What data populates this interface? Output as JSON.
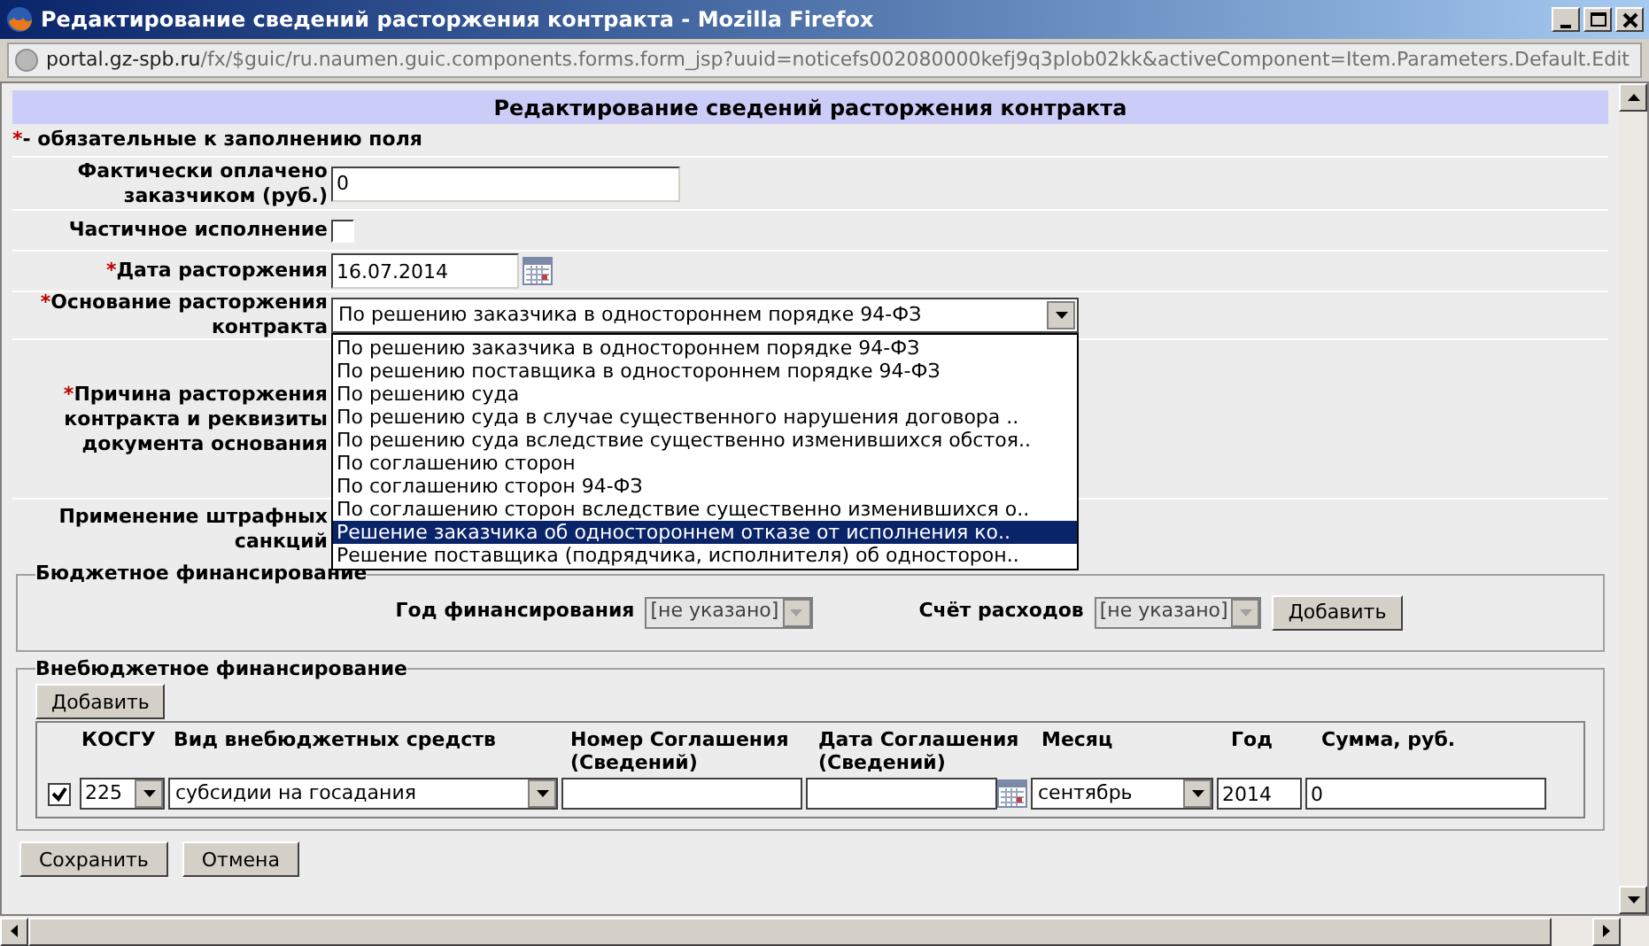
{
  "window": {
    "title": "Редактирование сведений расторжения контракта - Mozilla Firefox",
    "url_host": "portal.gz-spb.ru",
    "url_path": "/fx/$guic/ru.naumen.guic.components.forms.form_jsp?uuid=noticefs002080000kefj9q3plob02kk&activeComponent=Item.Parameters.Default.Edit"
  },
  "form": {
    "title": "Редактирование сведений расторжения контракта",
    "required_mark": "*",
    "required_note": " - обязательные к заполнению поля",
    "fields": [
      {
        "kind": "text",
        "label": "Фактически оплачено заказчиком (руб.)",
        "required": false,
        "value": "0"
      },
      {
        "kind": "checkbox",
        "label": "Частичное исполнение",
        "required": false,
        "checked": false
      },
      {
        "kind": "date",
        "label": "Дата расторжения",
        "required": true,
        "value": "16.07.2014"
      },
      {
        "kind": "select",
        "label": "Основание расторжения контракта",
        "required": true,
        "value": "По решению заказчика в одностороннем порядке 94-ФЗ",
        "expanded": true,
        "options": [
          {
            "label": "По решению заказчика в одностороннем порядке 94-ФЗ",
            "highlighted": false
          },
          {
            "label": "По решению поставщика в одностороннем порядке 94-ФЗ",
            "highlighted": false
          },
          {
            "label": "По решению суда",
            "highlighted": false
          },
          {
            "label": "По решению суда в случае существенного нарушения договора ..",
            "highlighted": false
          },
          {
            "label": "По решению суда вследствие существенно изменившихся обстоя..",
            "highlighted": false
          },
          {
            "label": "По соглашению сторон",
            "highlighted": false
          },
          {
            "label": "По соглашению сторон 94-ФЗ",
            "highlighted": false
          },
          {
            "label": "По соглашению сторон вследствие существенно изменившихся о..",
            "highlighted": false
          },
          {
            "label": "Решение заказчика об одностороннем отказе от исполнения ко..",
            "highlighted": true
          },
          {
            "label": "Решение поставщика (подрядчика, исполнителя) об односторон..",
            "highlighted": false
          }
        ]
      },
      {
        "kind": "tall",
        "label": "Причина расторжения контракта и реквизиты документа основания",
        "required": true
      },
      {
        "kind": "blank",
        "label": "Применение штрафных санкций",
        "required": false
      }
    ]
  },
  "budget": {
    "legend": "Бюджетное финансирование",
    "year_label": "Год финансирования",
    "year_value": "[не указано]",
    "account_label": "Счёт расходов",
    "account_value": "[не указано]",
    "disabled": true,
    "add_button": "Добавить"
  },
  "offbudget": {
    "legend": "Внебюджетное финансирование",
    "add_button": "Добавить",
    "columns": [
      "КОСГУ",
      "Вид внебюджетных средств",
      "Номер Соглашения (Сведений)",
      "Дата Соглашения (Сведений)",
      "Месяц",
      "Год",
      "Сумма, руб."
    ],
    "rows": [
      {
        "checked": true,
        "kosgu": "225",
        "type": "субсидии на госадания",
        "month": "сентябрь",
        "year": "2014",
        "sum": "0"
      }
    ]
  },
  "buttons": [
    "Сохранить",
    "Отмена"
  ]
}
